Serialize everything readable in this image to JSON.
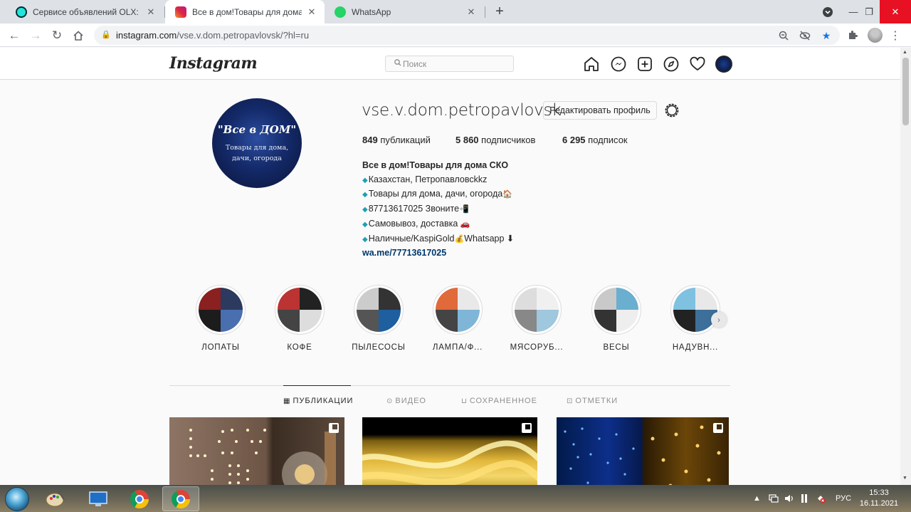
{
  "browser": {
    "tabs": [
      {
        "title": "Сервисе объявлений OLX: сайт м",
        "favicon_color": "#23e5db"
      },
      {
        "title": "Все в дом!Товары для дома СКО",
        "favicon_color": "#d6249f"
      },
      {
        "title": "WhatsApp",
        "favicon_color": "#25d366"
      }
    ],
    "new_tab_label": "+",
    "url_host": "instagram.com",
    "url_path": "/vse.v.dom.petropavlovsk/?hl=ru"
  },
  "instagram": {
    "logo": "Instagram",
    "search_placeholder": "Поиск",
    "profile": {
      "username": "vse.v.dom.petropavlovsk",
      "edit_button": "Редактировать профиль",
      "avatar_title": "\"Все в ДОМ\"",
      "avatar_subtitle": "Товары для дома, дачи, огорода",
      "stats": {
        "posts_count": "849",
        "posts_label": "публикаций",
        "followers_count": "5 860",
        "followers_label": "подписчиков",
        "following_count": "6 295",
        "following_label": "подписок"
      },
      "bio": {
        "name": "Все в дом!Товары для дома СКО",
        "lines": [
          "Казахстан, Петропавловсkkz",
          "Товары для дома, дачи, огорода",
          "87713617025 Звоните",
          "Самовывоз, доставка",
          "Наличные/KaspiGold",
          "Whatsapp ⬇"
        ],
        "link": "wa.me/77713617025"
      }
    },
    "highlights": [
      {
        "label": "ЛОПАТЫ"
      },
      {
        "label": "КОФЕ"
      },
      {
        "label": "ПЫЛЕСОСЫ"
      },
      {
        "label": "ЛАМПА/Ф..."
      },
      {
        "label": "МЯСОРУБ..."
      },
      {
        "label": "ВЕСЫ"
      },
      {
        "label": "НАДУВН..."
      }
    ],
    "tabs": {
      "posts": "ПУБЛИКАЦИИ",
      "video": "ВИДЕО",
      "saved": "СОХРАНЕННОЕ",
      "tagged": "ОТМЕТКИ"
    }
  },
  "taskbar": {
    "language": "РУС",
    "time": "15:33",
    "date": "16.11.2021"
  }
}
